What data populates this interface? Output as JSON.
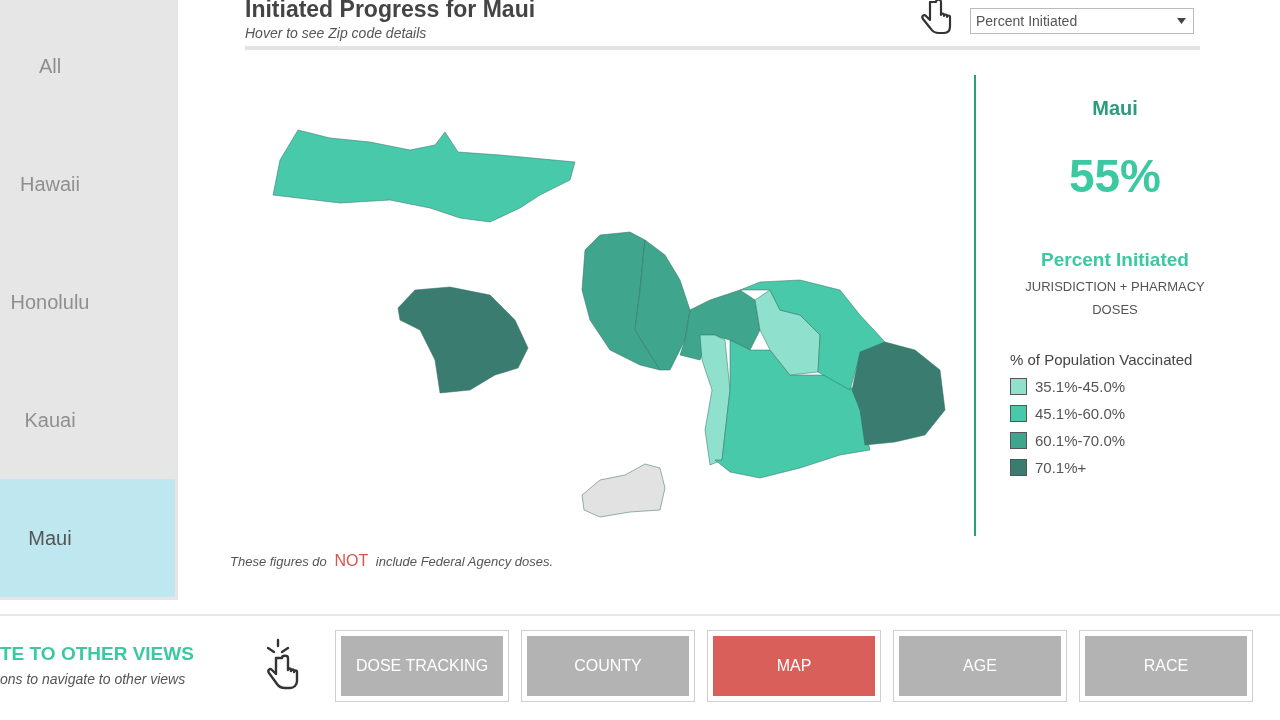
{
  "sidebar": {
    "items": [
      {
        "label": "All",
        "selected": false
      },
      {
        "label": "Hawaii",
        "selected": false
      },
      {
        "label": "Honolulu",
        "selected": false
      },
      {
        "label": "Kauai",
        "selected": false
      },
      {
        "label": "Maui",
        "selected": true
      }
    ]
  },
  "header": {
    "title": "Initiated Progress for Maui",
    "subtitle": "Hover to see Zip code details",
    "dropdown": {
      "value": "Percent Initiated"
    }
  },
  "map": {
    "regions": [
      {
        "color": "#48c9a9"
      },
      {
        "color": "#3a7d70"
      },
      {
        "color": "#e2e2e2"
      },
      {
        "color": "#3fa58c"
      },
      {
        "color": "#3fa58c"
      },
      {
        "color": "#3fa58c"
      },
      {
        "color": "#8fe0cc"
      },
      {
        "color": "#48c9a9"
      },
      {
        "color": "#8fe0cc"
      },
      {
        "color": "#48c9a9"
      },
      {
        "color": "#3a7d70"
      }
    ]
  },
  "summary": {
    "area": "Maui",
    "value": "55%",
    "metric": "Percent Initiated",
    "metric_note": "JURISDICTION + PHARMACY DOSES",
    "legend": {
      "title": "% of Population Vaccinated",
      "items": [
        {
          "label": "35.1%-45.0%",
          "color": "#8fe0cc"
        },
        {
          "label": "45.1%-60.0%",
          "color": "#48c9a9"
        },
        {
          "label": "60.1%-70.0%",
          "color": "#3fa58c"
        },
        {
          "label": "70.1%+",
          "color": "#3a7d70"
        }
      ]
    }
  },
  "footnote": "These figures do **NOT** include  Federal Agency doses.",
  "nav": {
    "title": "TE TO OTHER VIEWS",
    "subtitle": "ons to navigate to other views",
    "buttons": [
      {
        "label": "DOSE TRACKING",
        "selected": false
      },
      {
        "label": "COUNTY",
        "selected": false
      },
      {
        "label": "MAP",
        "selected": true
      },
      {
        "label": "AGE",
        "selected": false
      },
      {
        "label": "RACE",
        "selected": false
      }
    ]
  }
}
